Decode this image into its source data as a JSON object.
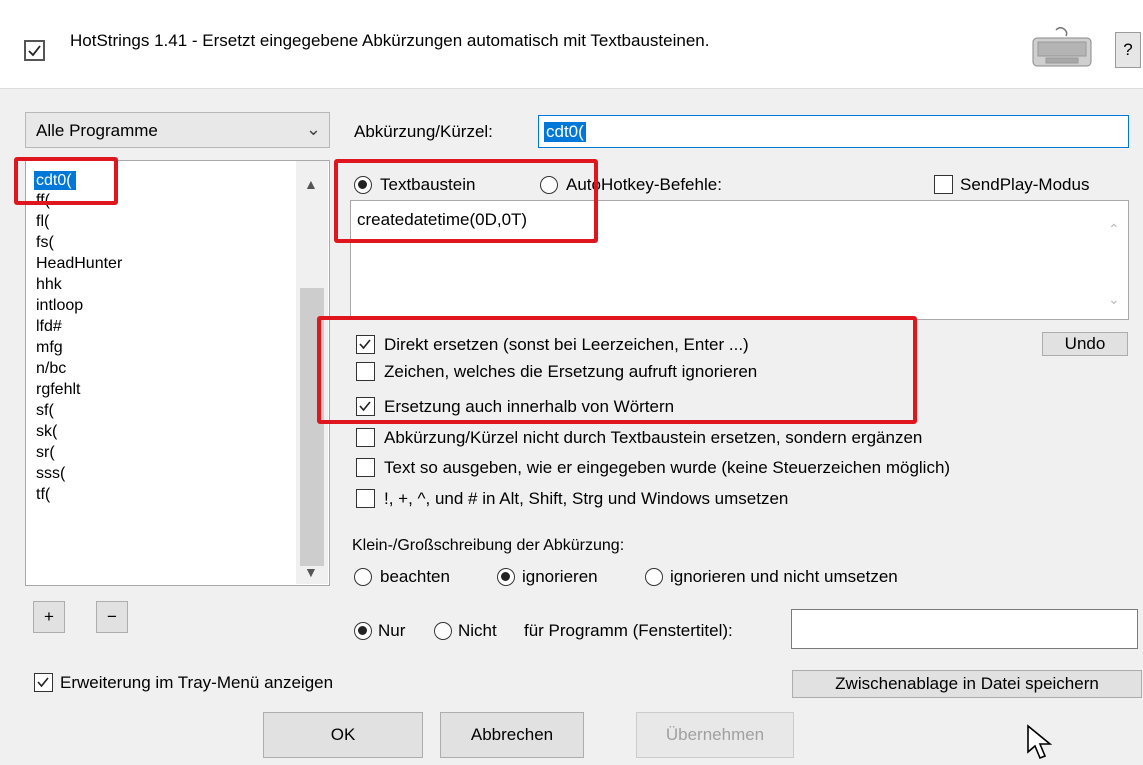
{
  "header": {
    "title": "HotStrings 1.41 - Ersetzt eingegebene Abkürzungen automatisch mit Textbausteinen.",
    "enabled": true,
    "help_label": "?",
    "keyboard_icon": "keyboard-icon"
  },
  "program_filter": {
    "value": "Alle Programme"
  },
  "hotstring_list": {
    "items": [
      "cdt0(",
      "ff(",
      "fl(",
      "fs(",
      "HeadHunter",
      "hhk",
      "intloop",
      "lfd#",
      "mfg",
      "n/bc",
      "rgfehlt",
      "sf(",
      "sk(",
      "sr(",
      "sss(",
      "tf("
    ],
    "selected": "cdt0("
  },
  "list_buttons": {
    "add": "+",
    "remove": "−"
  },
  "abbreviation": {
    "label": "Abkürzung/Kürzel:",
    "value": "cdt0("
  },
  "mode": {
    "textbaustein": "Textbaustein",
    "autohotkey": "AutoHotkey-Befehle:",
    "selected": "Textbaustein",
    "sendplay": "SendPlay-Modus"
  },
  "replacement_text": "createdatetime(0D,0T)",
  "undo_label": "Undo",
  "options": [
    {
      "label": "Direkt ersetzen (sonst bei Leerzeichen, Enter ...)",
      "checked": true
    },
    {
      "label": "Zeichen, welches die Ersetzung aufruft ignorieren",
      "checked": false
    },
    {
      "label": "Ersetzung auch innerhalb von Wörtern",
      "checked": true
    },
    {
      "label": "Abkürzung/Kürzel nicht durch Textbaustein ersetzen, sondern ergänzen",
      "checked": false
    },
    {
      "label": "Text so ausgeben, wie er eingegeben wurde (keine Steuerzeichen möglich)",
      "checked": false
    },
    {
      "label": "!, +, ^, und # in Alt, Shift, Strg und Windows umsetzen",
      "checked": false
    }
  ],
  "case": {
    "label": "Klein-/Großschreibung der Abkürzung:",
    "options": [
      "beachten",
      "ignorieren",
      "ignorieren und nicht umsetzen"
    ],
    "selected": "ignorieren"
  },
  "program_scope": {
    "nur": "Nur",
    "nicht": "Nicht",
    "label": "für Programm (Fenstertitel):",
    "selected": "Nur",
    "value": ""
  },
  "tray": {
    "label": "Erweiterung im Tray-Menü anzeigen",
    "checked": true
  },
  "clipboard_button": "Zwischenablage in Datei speichern",
  "footer": {
    "ok": "OK",
    "cancel": "Abbrechen",
    "apply": "Übernehmen"
  },
  "colors": {
    "highlight": "#e0161f",
    "selection": "#0078d7"
  }
}
